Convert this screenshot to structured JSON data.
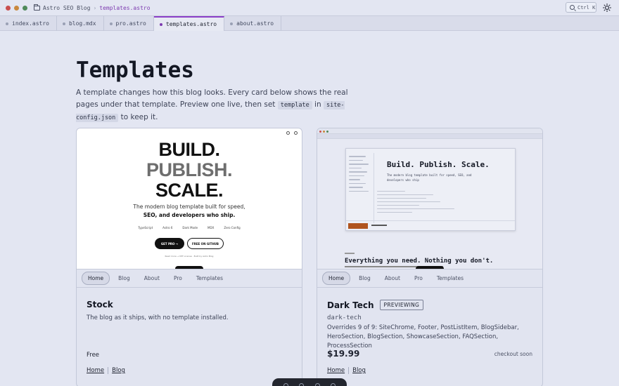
{
  "window": {
    "title": "Astro SEO Blog",
    "path_sep": "›",
    "current_file": "templates.astro",
    "search_shortcut": "Ctrl K"
  },
  "tabs": [
    {
      "label": "index.astro",
      "active": false
    },
    {
      "label": "blog.mdx",
      "active": false
    },
    {
      "label": "pro.astro",
      "active": false
    },
    {
      "label": "templates.astro",
      "active": true
    },
    {
      "label": "about.astro",
      "active": false
    }
  ],
  "page": {
    "title": "Templates",
    "intro_1": "A template changes how this blog looks. Every card below shows the real pages under that template. Preview one live, then set ",
    "intro_code_1": "template",
    "intro_2": " in ",
    "intro_code_2": "site-config.json",
    "intro_3": " to keep it."
  },
  "nav_links": [
    "Home",
    "Blog",
    "About",
    "Pro",
    "Templates"
  ],
  "cards": [
    {
      "name": "Stock",
      "description": "The blog as it ships, with no template installed.",
      "price": "Free",
      "links": [
        "Home",
        "Blog"
      ],
      "preview": {
        "line1": "BUILD.",
        "line2": "PUBLISH.",
        "line3": "SCALE.",
        "subtitle_1": "The modern blog template built for speed,",
        "subtitle_2": "SEO, and developers who ship.",
        "tags": [
          "TypeScript",
          "Astro 6",
          "Dark Mode",
          "MDX",
          "Zero Config"
        ],
        "primary_button": "GET PRO →",
        "secondary_button": "FREE ON GITHUB",
        "footnote": "Read more → MIT License · Built by Astro Blog"
      }
    },
    {
      "name": "Dark Tech",
      "badge": "PREVIEWING",
      "slug": "dark-tech",
      "description": "Overrides 9 of 9: SiteChrome, Footer, PostListItem, BlogSidebar, HeroSection, BlogSection, ShowcaseSection, FAQSection, ProcessSection",
      "price": "$19.99",
      "checkout": "checkout soon",
      "links": [
        "Home",
        "Blog"
      ],
      "preview": {
        "hero": "Build. Publish. Scale.",
        "hero_sub": "The modern blog template built for speed, SEO, and developers who ship",
        "headline": "Everything you need. Nothing you don't."
      }
    }
  ],
  "colors": {
    "background": "#e3e6f2",
    "accent": "#8a3fc8",
    "dot_red": "#c94f4f",
    "dot_amber": "#c9883d",
    "dot_green": "#4f8a5a",
    "orange_button": "#b0541e"
  }
}
